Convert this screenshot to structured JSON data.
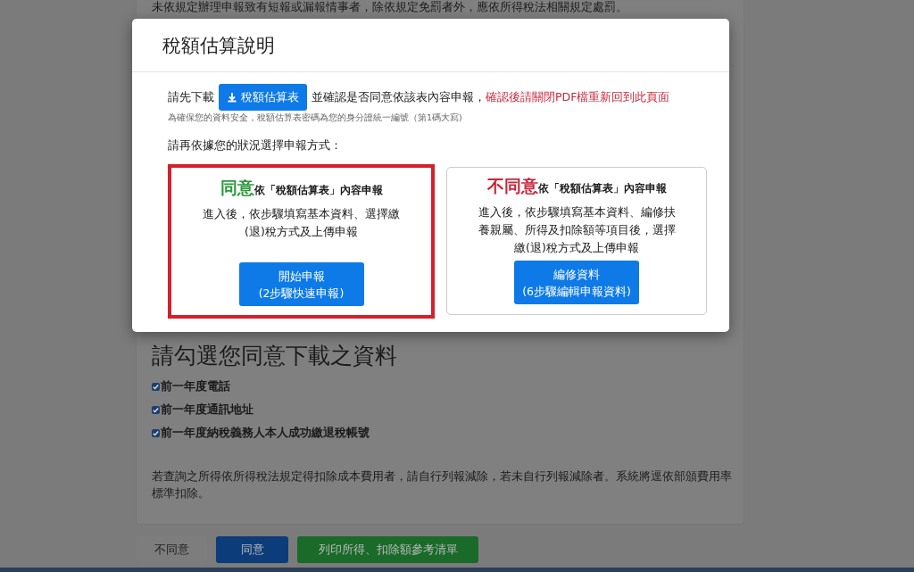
{
  "page": {
    "notice": "未依規定辦理申報致有短報或漏報情事者，除依規定免罰者外，應依所得稅法相關規定處罰。",
    "heading": "請勾選您同意下載之資料",
    "checkboxes": [
      {
        "label": "前一年度電話",
        "checked": true
      },
      {
        "label": "前一年度通訊地址",
        "checked": true
      },
      {
        "label": "前一年度納稅義務人本人成功繳退稅帳號",
        "checked": true
      }
    ],
    "note": "若查詢之所得依所得稅法規定得扣除成本費用者，請自行列報減除，若未自行列報減除者。系統將逕依部頒費用率標準扣除。",
    "buttons": [
      {
        "label": "不同意",
        "kind": "light"
      },
      {
        "label": "同意",
        "kind": "primary"
      },
      {
        "label": "列印所得、扣除額參考清單",
        "kind": "success"
      }
    ]
  },
  "modal": {
    "title": "稅額估算說明",
    "download_prefix": "請先下載",
    "download_button": "稅額估算表",
    "download_suffix": "並確認是否同意依該表內容申報，",
    "warning": "確認後請關閉PDF檔重新回到此頁面",
    "hint": "為確保您的資料安全，稅額估算表密碼為您的身分證統一編號（第1碼大寫)",
    "prompt": "請再依據您的狀況選擇申報方式：",
    "options": [
      {
        "highlight": "同意",
        "color": "#2a9a3a",
        "heading": "依「稅額估算表」內容申報",
        "description": "進入後，依步驟填寫基本資料、選擇繳(退)稅方式及上傳申報",
        "button_lines": [
          "開始申報",
          "(2步驟快速申報)"
        ],
        "selected": true
      },
      {
        "highlight": "不同意",
        "color": "#c8283c",
        "heading": "依「稅額估算表」內容申報",
        "description": "進入後，依步驟填寫基本資料、編修扶養親屬、所得及扣除額等項目後，選擇繳(退)稅方式及上傳申報",
        "button_lines": [
          "編修資料",
          "(6步驟編輯申報資料)"
        ],
        "selected": false
      }
    ]
  }
}
